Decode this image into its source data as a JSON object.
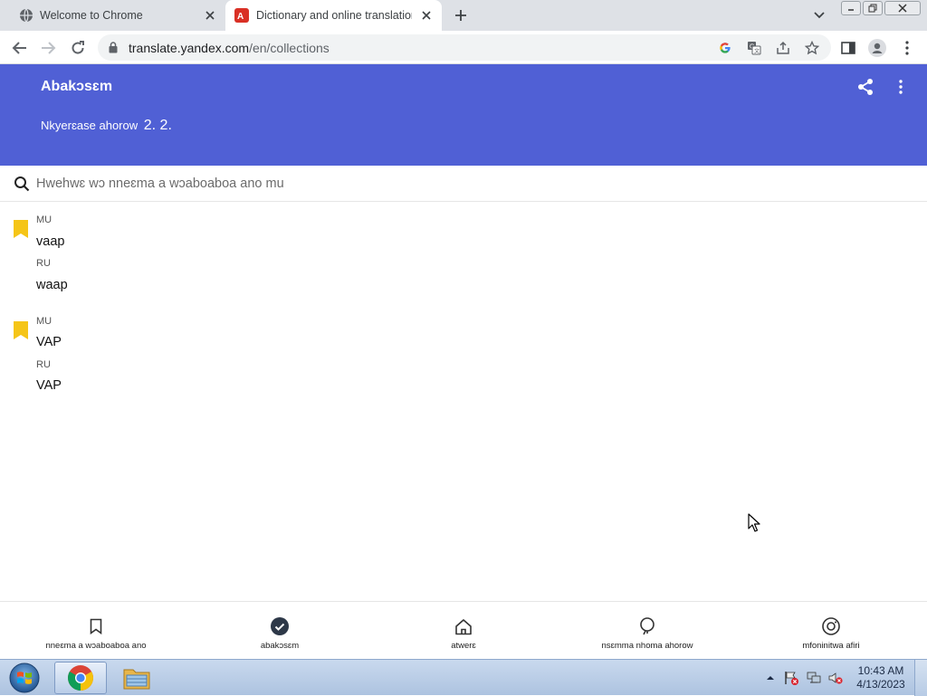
{
  "browser": {
    "tabs": [
      {
        "title": "Welcome to Chrome",
        "icon": "chrome-globe-icon"
      },
      {
        "title": "Dictionary and online translation",
        "icon": "yandex-translate-icon"
      }
    ],
    "url_host": "translate.yandex.com",
    "url_path": "/en/collections"
  },
  "header": {
    "title": "Abakɔsɛm",
    "subtitle": "Nkyerɛase ahorow",
    "count": "2. 2."
  },
  "search": {
    "placeholder": "Hwehwɛ wɔ nneɛma a wɔaboaboa ano mu"
  },
  "entries": [
    {
      "source_lang": "MU",
      "source_word": "vaap",
      "target_lang": "RU",
      "target_word": "waap"
    },
    {
      "source_lang": "MU",
      "source_word": "VAP",
      "target_lang": "RU",
      "target_word": "VAP"
    }
  ],
  "bottom_nav": [
    {
      "label": "nneɛma a wɔaboaboa ano",
      "icon": "bookmark-icon"
    },
    {
      "label": "abakɔsɛm",
      "icon": "history-check-icon"
    },
    {
      "label": "atwerɛ",
      "icon": "home-icon"
    },
    {
      "label": "nsɛmma nhoma ahorow",
      "icon": "lightbulb-icon"
    },
    {
      "label": "mfoninitwa afiri",
      "icon": "camera-icon"
    }
  ],
  "taskbar": {
    "time": "10:43 AM",
    "date": "4/13/2023"
  },
  "colors": {
    "header_bg": "#5060d5",
    "bookmark": "#f5c518"
  }
}
